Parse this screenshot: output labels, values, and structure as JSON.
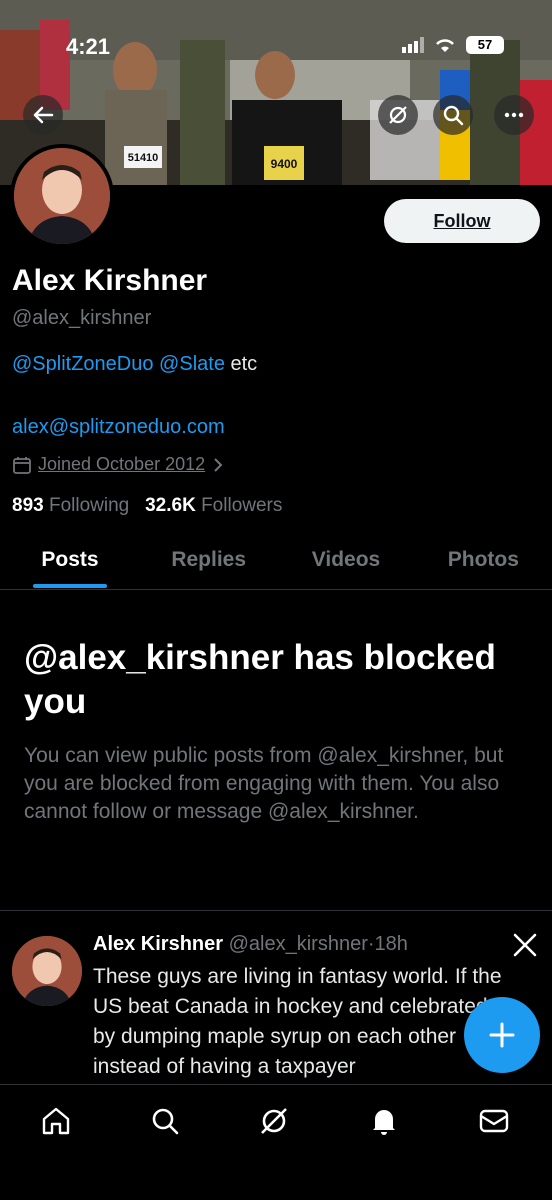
{
  "status_bar": {
    "time": "4:21",
    "battery": "57"
  },
  "profile": {
    "name": "Alex Kirshner",
    "handle": "@alex_kirshner",
    "bio_link_1": "@SplitZoneDuo",
    "bio_link_2": "@Slate",
    "bio_rest": "etc",
    "email": "alex@splitzoneduo.com",
    "joined": "Joined October 2012",
    "following_count": "893",
    "following_label": "Following",
    "followers_count": "32.6K",
    "followers_label": "Followers",
    "follow_button": "Follow"
  },
  "banner": {
    "bib_1": "51410",
    "bib_2": "9400"
  },
  "tabs": [
    {
      "label": "Posts",
      "active": true
    },
    {
      "label": "Replies",
      "active": false
    },
    {
      "label": "Videos",
      "active": false
    },
    {
      "label": "Photos",
      "active": false
    }
  ],
  "blocked": {
    "title": "@alex_kirshner has blocked you",
    "body": "You can view public posts from @alex_kirshner, but you are blocked from engaging with them. You also cannot follow or message @alex_kirshner."
  },
  "post": {
    "author": "Alex Kirshner",
    "handle": "@alex_kirshner",
    "separator": "·",
    "time": "18h",
    "text": "These guys are living in fantasy world. If the US beat Canada in hockey and celebrated by dumping maple syrup on each other instead of having a taxpayer"
  },
  "colors": {
    "accent": "#1d9bf0",
    "background": "#000000",
    "muted": "#71767b"
  },
  "icons": [
    "back-arrow-icon",
    "grok-icon",
    "search-icon",
    "more-icon",
    "calendar-icon",
    "chevron-right-icon",
    "x-logo-icon",
    "plus-icon",
    "home-icon",
    "explore-search-icon",
    "grok-nav-icon",
    "bell-icon",
    "mail-icon"
  ]
}
